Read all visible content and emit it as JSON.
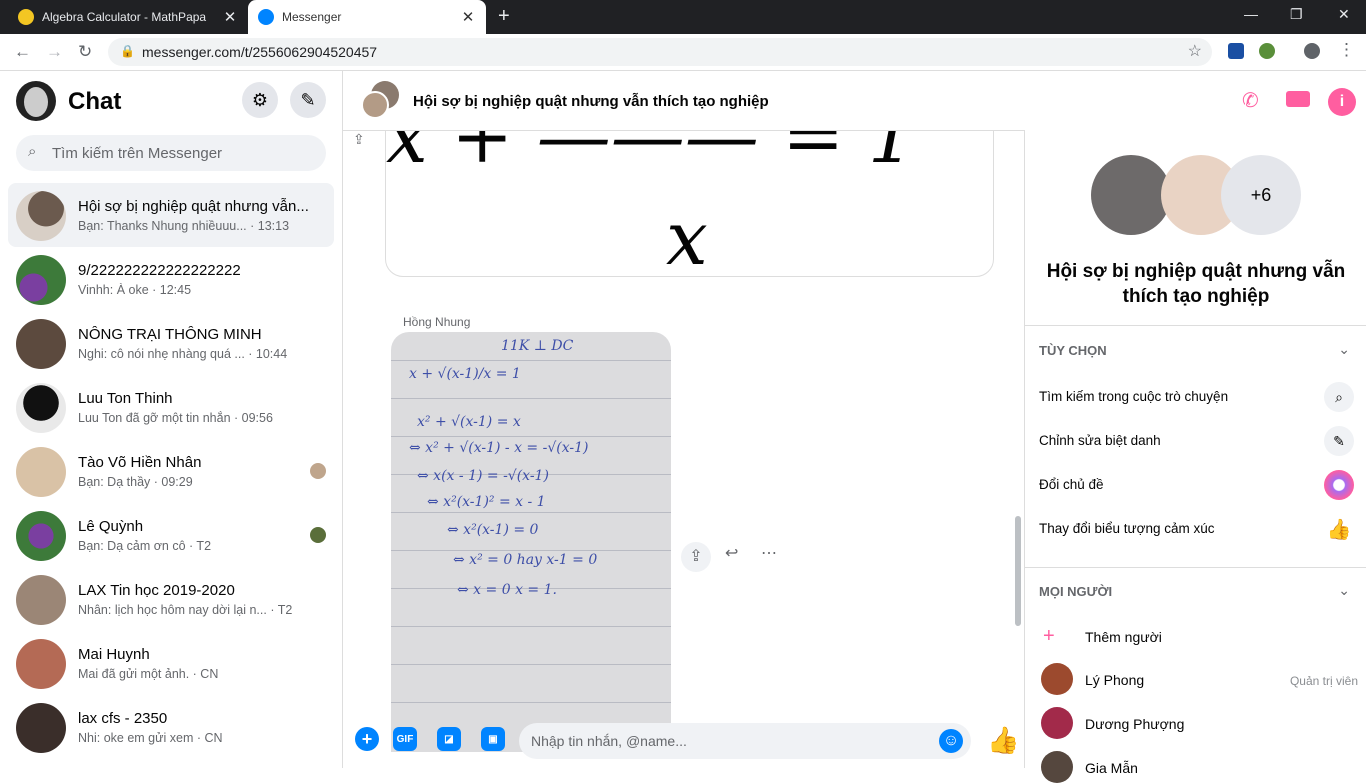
{
  "browser": {
    "tabs": [
      {
        "title": "Algebra Calculator - MathPapa",
        "close": "✕"
      },
      {
        "title": "Messenger",
        "close": "✕"
      }
    ],
    "new_tab": "+",
    "url": "messenger.com/t/2556062904520457"
  },
  "sidebar": {
    "title": "Chat",
    "search_placeholder": "Tìm kiếm trên Messenger",
    "conversations": [
      {
        "name": "Hội sợ bị nghiệp quật nhưng vẫn...",
        "preview": "Bạn: Thanks Nhung nhiềuuu... · 13:13"
      },
      {
        "name": "9/222222222222222222",
        "preview": "Vinhh: À oke · 12:45"
      },
      {
        "name": "NÔNG TRẠI THÔNG MINH",
        "preview": "Nghi: cô nói nhẹ nhàng quá ... · 10:44"
      },
      {
        "name": "Luu Ton Thinh",
        "preview": "Luu Ton đã gỡ một tin nhắn · 09:56"
      },
      {
        "name": "Tào Võ Hiền Nhân",
        "preview": "Bạn: Dạ thầy · 09:29"
      },
      {
        "name": "Lê Quỳnh",
        "preview": "Bạn: Dạ cảm ơn cô · T2"
      },
      {
        "name": "LAX Tin học 2019-2020",
        "preview": "Nhân: lịch học hôm nay dời lại n... · T2"
      },
      {
        "name": "Mai Huynh",
        "preview": "Mai đã gửi một ảnh. · CN"
      },
      {
        "name": "lax cfs - 2350",
        "preview": "Nhi: oke em gửi xem · CN"
      }
    ]
  },
  "chat": {
    "title": "Hội sợ bị nghiệp quật nhưng vẫn thích tạo nghiệp",
    "math_top": "x + ——— = 1",
    "math_x": "x",
    "sender": "Hồng Nhung",
    "handwriting": [
      "11K ⊥ DC",
      "x + √(x-1)/x = 1",
      "x² + √(x-1) = x",
      "⇔ x² + √(x-1) - x = -√(x-1)",
      "⇔ x(x - 1) = -√(x-1)",
      "⇔ x²(x-1)² = x - 1",
      "⇔ x²(x-1) = 0",
      "⇔ x² = 0     hay   x-1 = 0",
      "⇔ x = 0            x = 1."
    ],
    "composer_placeholder": "Nhập tin nhắn, @name...",
    "gif_label": "GIF"
  },
  "info": {
    "extra_members": "+6",
    "name": "Hội sợ bị nghiệp quật nhưng vẫn thích tạo nghiệp",
    "options_header": "TÙY CHỌN",
    "options": [
      {
        "label": "Tìm kiếm trong cuộc trò chuyện",
        "icon": "search-icon"
      },
      {
        "label": "Chỉnh sửa biệt danh",
        "icon": "pencil-icon"
      },
      {
        "label": "Đổi chủ đề",
        "icon": "theme-icon"
      },
      {
        "label": "Thay đổi biểu tượng cảm xúc",
        "icon": "like-icon"
      }
    ],
    "people_header": "MỌI NGƯỜI",
    "add_people": "Thêm người",
    "members": [
      {
        "name": "Lý Phong",
        "role": "Quản trị viên"
      },
      {
        "name": "Dương Phượng",
        "role": ""
      },
      {
        "name": "Gia Mẫn",
        "role": ""
      }
    ]
  },
  "colors": {
    "accent": "#0084ff",
    "call": "#ff5ea0"
  }
}
